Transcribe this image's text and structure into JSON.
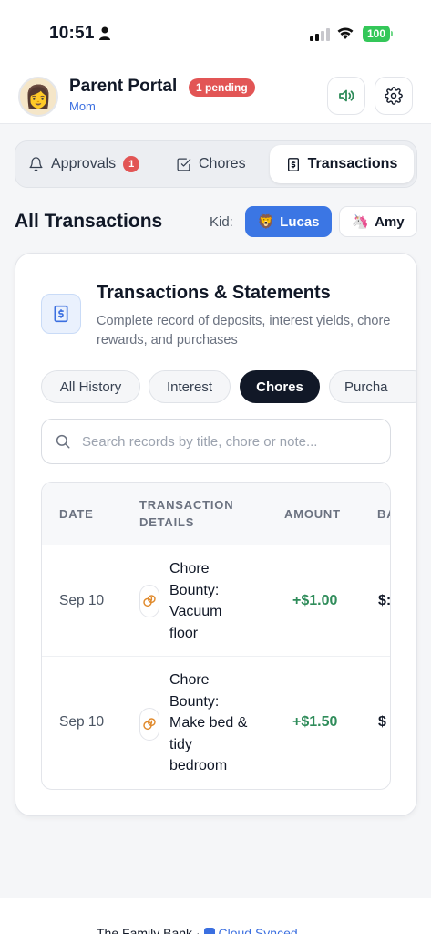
{
  "status_bar": {
    "time": "10:51",
    "battery": "100"
  },
  "header": {
    "title": "Parent Portal",
    "pending_badge": "1 pending",
    "subtitle": "Mom",
    "avatar_emoji": "👩"
  },
  "tabs": {
    "approvals": {
      "label": "Approvals",
      "badge": "1"
    },
    "chores": {
      "label": "Chores"
    },
    "transactions": {
      "label": "Transactions"
    }
  },
  "section": {
    "title": "All Transactions",
    "kid_label": "Kid:",
    "kids": [
      {
        "name": "Lucas",
        "emoji": "🦁",
        "selected": true
      },
      {
        "name": "Amy",
        "emoji": "🦄",
        "selected": false
      }
    ]
  },
  "card": {
    "title": "Transactions & Statements",
    "description": "Complete record of deposits, interest yields, chore rewards, and purchases",
    "filters": [
      "All History",
      "Interest",
      "Chores",
      "Purcha"
    ],
    "active_filter": "Chores",
    "search_placeholder": "Search records by title, chore or note...",
    "table": {
      "headers": {
        "date": "DATE",
        "details": "TRANSACTION DETAILS",
        "amount": "AMOUNT",
        "balance": "BA"
      },
      "rows": [
        {
          "date": "Sep 10",
          "title": "Chore Bounty: Vacuum floor",
          "amount": "+$1.00",
          "balance": "$:"
        },
        {
          "date": "Sep 10",
          "title": "Chore Bounty: Make bed & tidy bedroom",
          "amount": "+$1.50",
          "balance": "$"
        }
      ]
    }
  },
  "footer": {
    "app_name": "The Family Bank",
    "separator": "·",
    "sync_label": "Cloud Synced"
  },
  "colors": {
    "primary": "#3b76e4",
    "danger": "#e25555",
    "success": "#2f8c5a",
    "dark": "#111827"
  }
}
